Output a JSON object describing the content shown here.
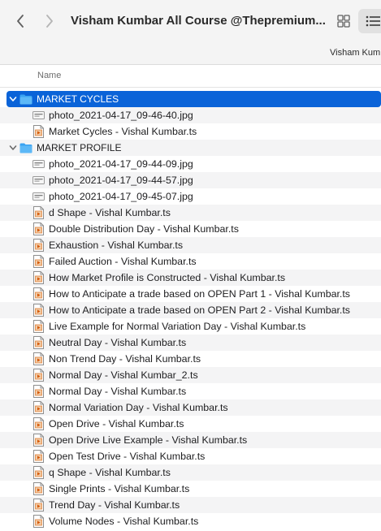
{
  "window": {
    "title": "Visham Kumbar All Course @Thepremium...",
    "path_label": "Visham Kum",
    "icons": {
      "back": "chevron-left-icon",
      "forward": "chevron-right-icon",
      "grid": "grid-view-icon",
      "list": "list-view-icon"
    }
  },
  "columns": {
    "name": "Name"
  },
  "colors": {
    "selection": "#0a63d8",
    "folder": "#3aa3f2",
    "stripe": "#f4f4f5"
  },
  "groups": [
    {
      "name": "MARKET CYCLES",
      "expanded": true,
      "selected": true,
      "items": [
        {
          "name": "photo_2021-04-17_09-46-40.jpg",
          "kind": "image"
        },
        {
          "name": "Market Cycles - Vishal Kumbar.ts",
          "kind": "video"
        }
      ]
    },
    {
      "name": "MARKET PROFILE",
      "expanded": true,
      "selected": false,
      "items": [
        {
          "name": "photo_2021-04-17_09-44-09.jpg",
          "kind": "image"
        },
        {
          "name": "photo_2021-04-17_09-44-57.jpg",
          "kind": "image"
        },
        {
          "name": "photo_2021-04-17_09-45-07.jpg",
          "kind": "image"
        },
        {
          "name": "d Shape - Vishal Kumbar.ts",
          "kind": "video"
        },
        {
          "name": "Double Distribution Day - Vishal Kumbar.ts",
          "kind": "video"
        },
        {
          "name": "Exhaustion - Vishal Kumbar.ts",
          "kind": "video"
        },
        {
          "name": "Failed Auction - Vishal Kumbar.ts",
          "kind": "video"
        },
        {
          "name": "How Market Profile is Constructed - Vishal Kumbar.ts",
          "kind": "video"
        },
        {
          "name": "How to Anticipate a trade based on OPEN Part 1 - Vishal Kumbar.ts",
          "kind": "video"
        },
        {
          "name": "How to Anticipate a trade based on OPEN Part 2 - Vishal Kumbar.ts",
          "kind": "video"
        },
        {
          "name": "Live Example for Normal Variation Day - Vishal Kumbar.ts",
          "kind": "video"
        },
        {
          "name": "Neutral Day - Vishal Kumbar.ts",
          "kind": "video"
        },
        {
          "name": "Non Trend Day - Vishal Kumbar.ts",
          "kind": "video"
        },
        {
          "name": "Normal Day - Vishal Kumbar_2.ts",
          "kind": "video"
        },
        {
          "name": "Normal Day - Vishal Kumbar.ts",
          "kind": "video"
        },
        {
          "name": "Normal Variation Day - Vishal Kumbar.ts",
          "kind": "video"
        },
        {
          "name": "Open Drive - Vishal Kumbar.ts",
          "kind": "video"
        },
        {
          "name": "Open Drive Live Example - Vishal Kumbar.ts",
          "kind": "video"
        },
        {
          "name": "Open Test Drive - Vishal Kumbar.ts",
          "kind": "video"
        },
        {
          "name": "q Shape - Vishal Kumbar.ts",
          "kind": "video"
        },
        {
          "name": "Single Prints - Vishal Kumbar.ts",
          "kind": "video"
        },
        {
          "name": "Trend Day - Vishal Kumbar.ts",
          "kind": "video"
        },
        {
          "name": "Volume Nodes - Vishal Kumbar.ts",
          "kind": "video"
        }
      ]
    }
  ]
}
